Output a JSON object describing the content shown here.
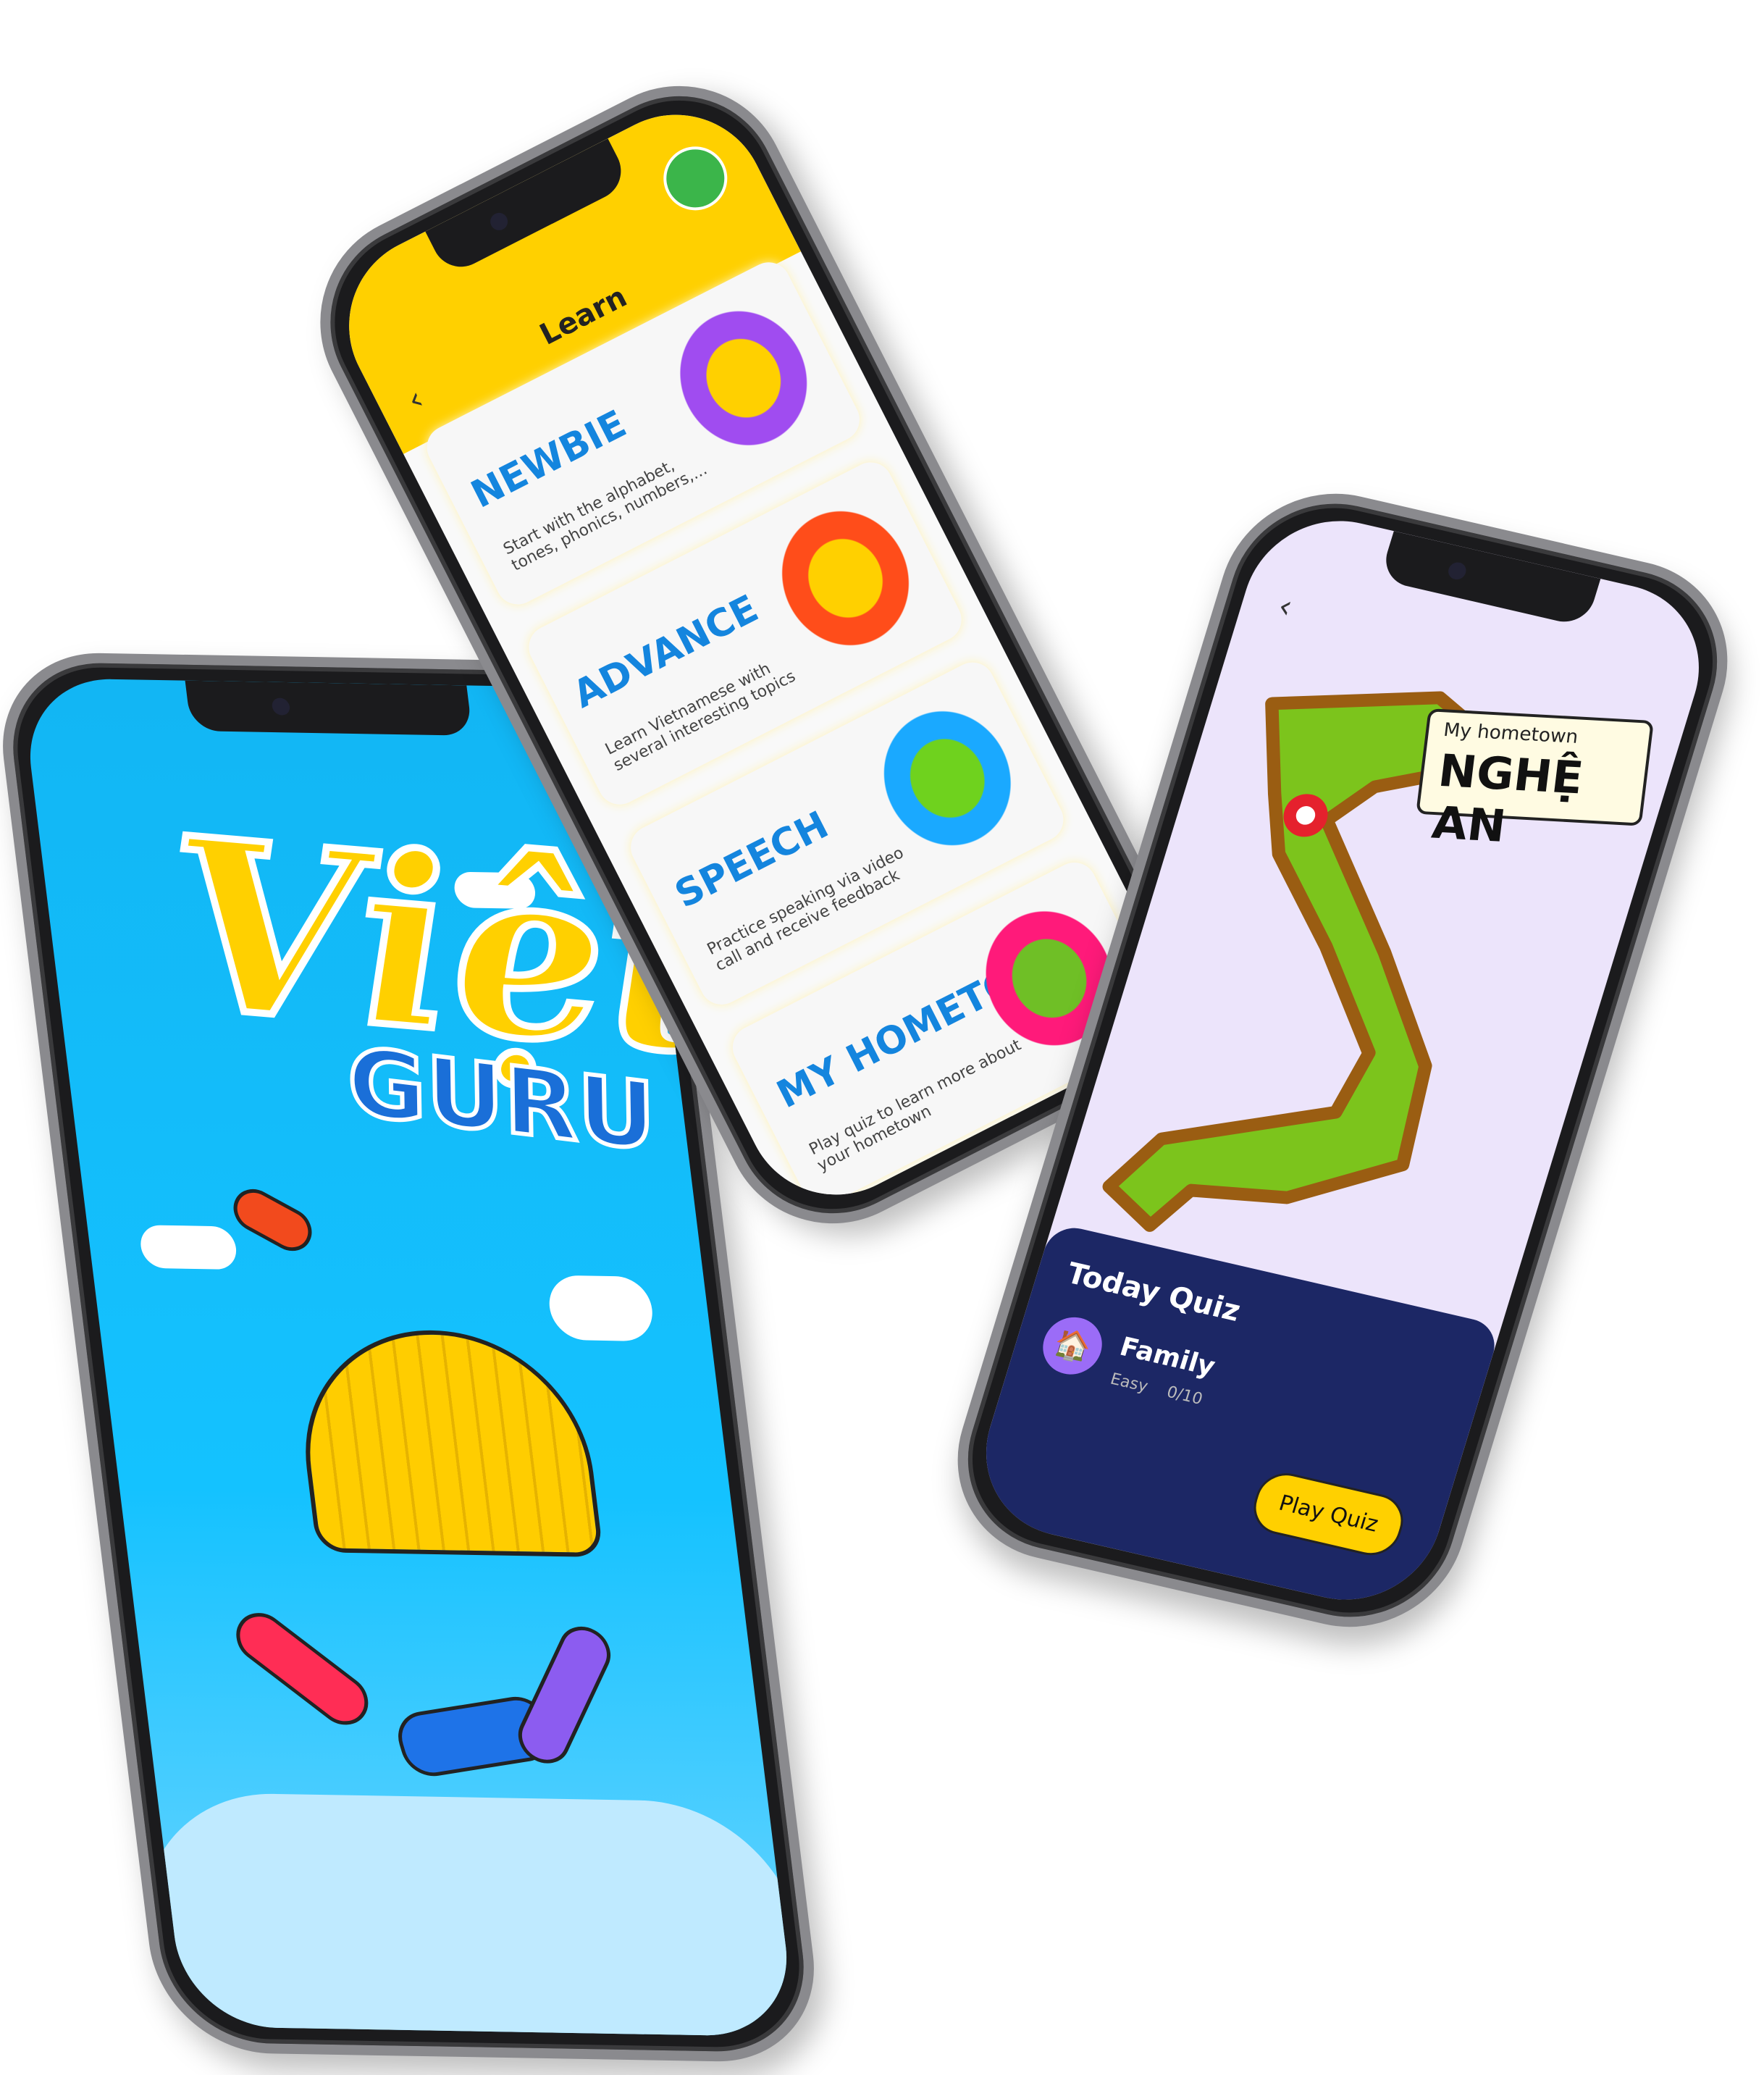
{
  "splash": {
    "logo_top": "Việt",
    "logo_bottom": "GURU"
  },
  "learn": {
    "title": "Learn",
    "back_icon": "chevron-left-icon",
    "cards": [
      {
        "title": "NEWBIE",
        "desc": "Start with the alphabet, tones, phonics, numbers,..."
      },
      {
        "title": "ADVANCE",
        "desc": "Learn Vietnamese with several interesting topics"
      },
      {
        "title": "SPEECH",
        "desc": "Practice speaking via video call and receive feedback"
      },
      {
        "title": "MY HOMETOWN",
        "desc": "Play quiz to learn more about your hometown"
      }
    ]
  },
  "hometown": {
    "label_small": "My hometown",
    "label_big": "NGHỆ AN",
    "quiz": {
      "title": "Today Quiz",
      "topic": "Family",
      "level": "Easy",
      "progress": "0/10",
      "button": "Play Quiz"
    }
  },
  "colors": {
    "yellow": "#ffd000",
    "blue": "#1485de",
    "navy": "#1c2765",
    "sky": "#14c2ff",
    "lavender": "#ece4fb"
  }
}
